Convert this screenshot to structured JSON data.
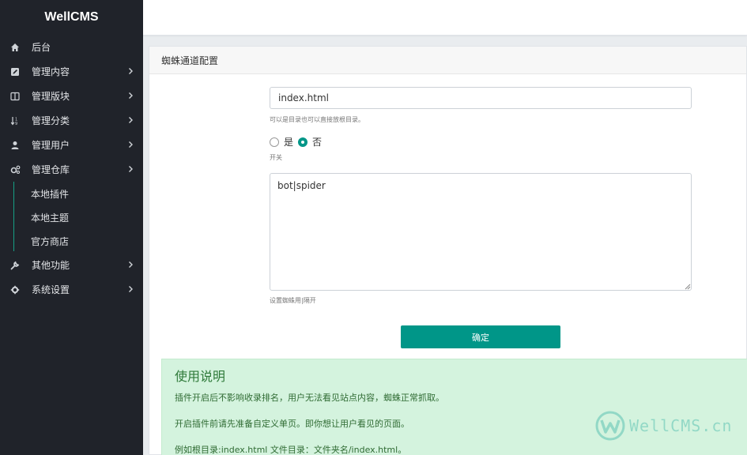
{
  "brand": "WellCMS",
  "sidebar": {
    "items": [
      {
        "label": "后台",
        "icon": "home-icon"
      },
      {
        "label": "管理内容",
        "icon": "edit-icon"
      },
      {
        "label": "管理版块",
        "icon": "columns-icon"
      },
      {
        "label": "管理分类",
        "icon": "sort-icon"
      },
      {
        "label": "管理用户",
        "icon": "user-icon"
      },
      {
        "label": "管理仓库",
        "icon": "cogs-icon"
      }
    ],
    "sub_items": [
      {
        "label": "本地插件"
      },
      {
        "label": "本地主题"
      },
      {
        "label": "官方商店"
      }
    ],
    "items_after": [
      {
        "label": "其他功能",
        "icon": "wrench-icon"
      },
      {
        "label": "系统设置",
        "icon": "gear-icon"
      }
    ]
  },
  "card": {
    "title": "蜘蛛通道配置"
  },
  "form": {
    "index_value": "index.html",
    "index_help": "可以是目录也可以直接放根目录。",
    "radio_yes": "是",
    "radio_no": "否",
    "switch_help": "开关",
    "spider_value": "bot|spider",
    "spider_help": "设置蜘蛛用|隔开",
    "submit_label": "确定"
  },
  "notice": {
    "title": "使用说明",
    "lines": [
      "插件开启后不影响收录排名，用户无法看见站点内容，蜘蛛正常抓取。",
      "开启插件前请先准备自定义单页。即你想让用户看见的页面。",
      "例如根目录:index.html 文件目录：文件夹名/index.html。"
    ]
  },
  "watermark": "WellCMS.cn",
  "colors": {
    "accent": "#009688",
    "sidebar_bg": "#20232a",
    "notice_bg": "#d4f3de"
  }
}
